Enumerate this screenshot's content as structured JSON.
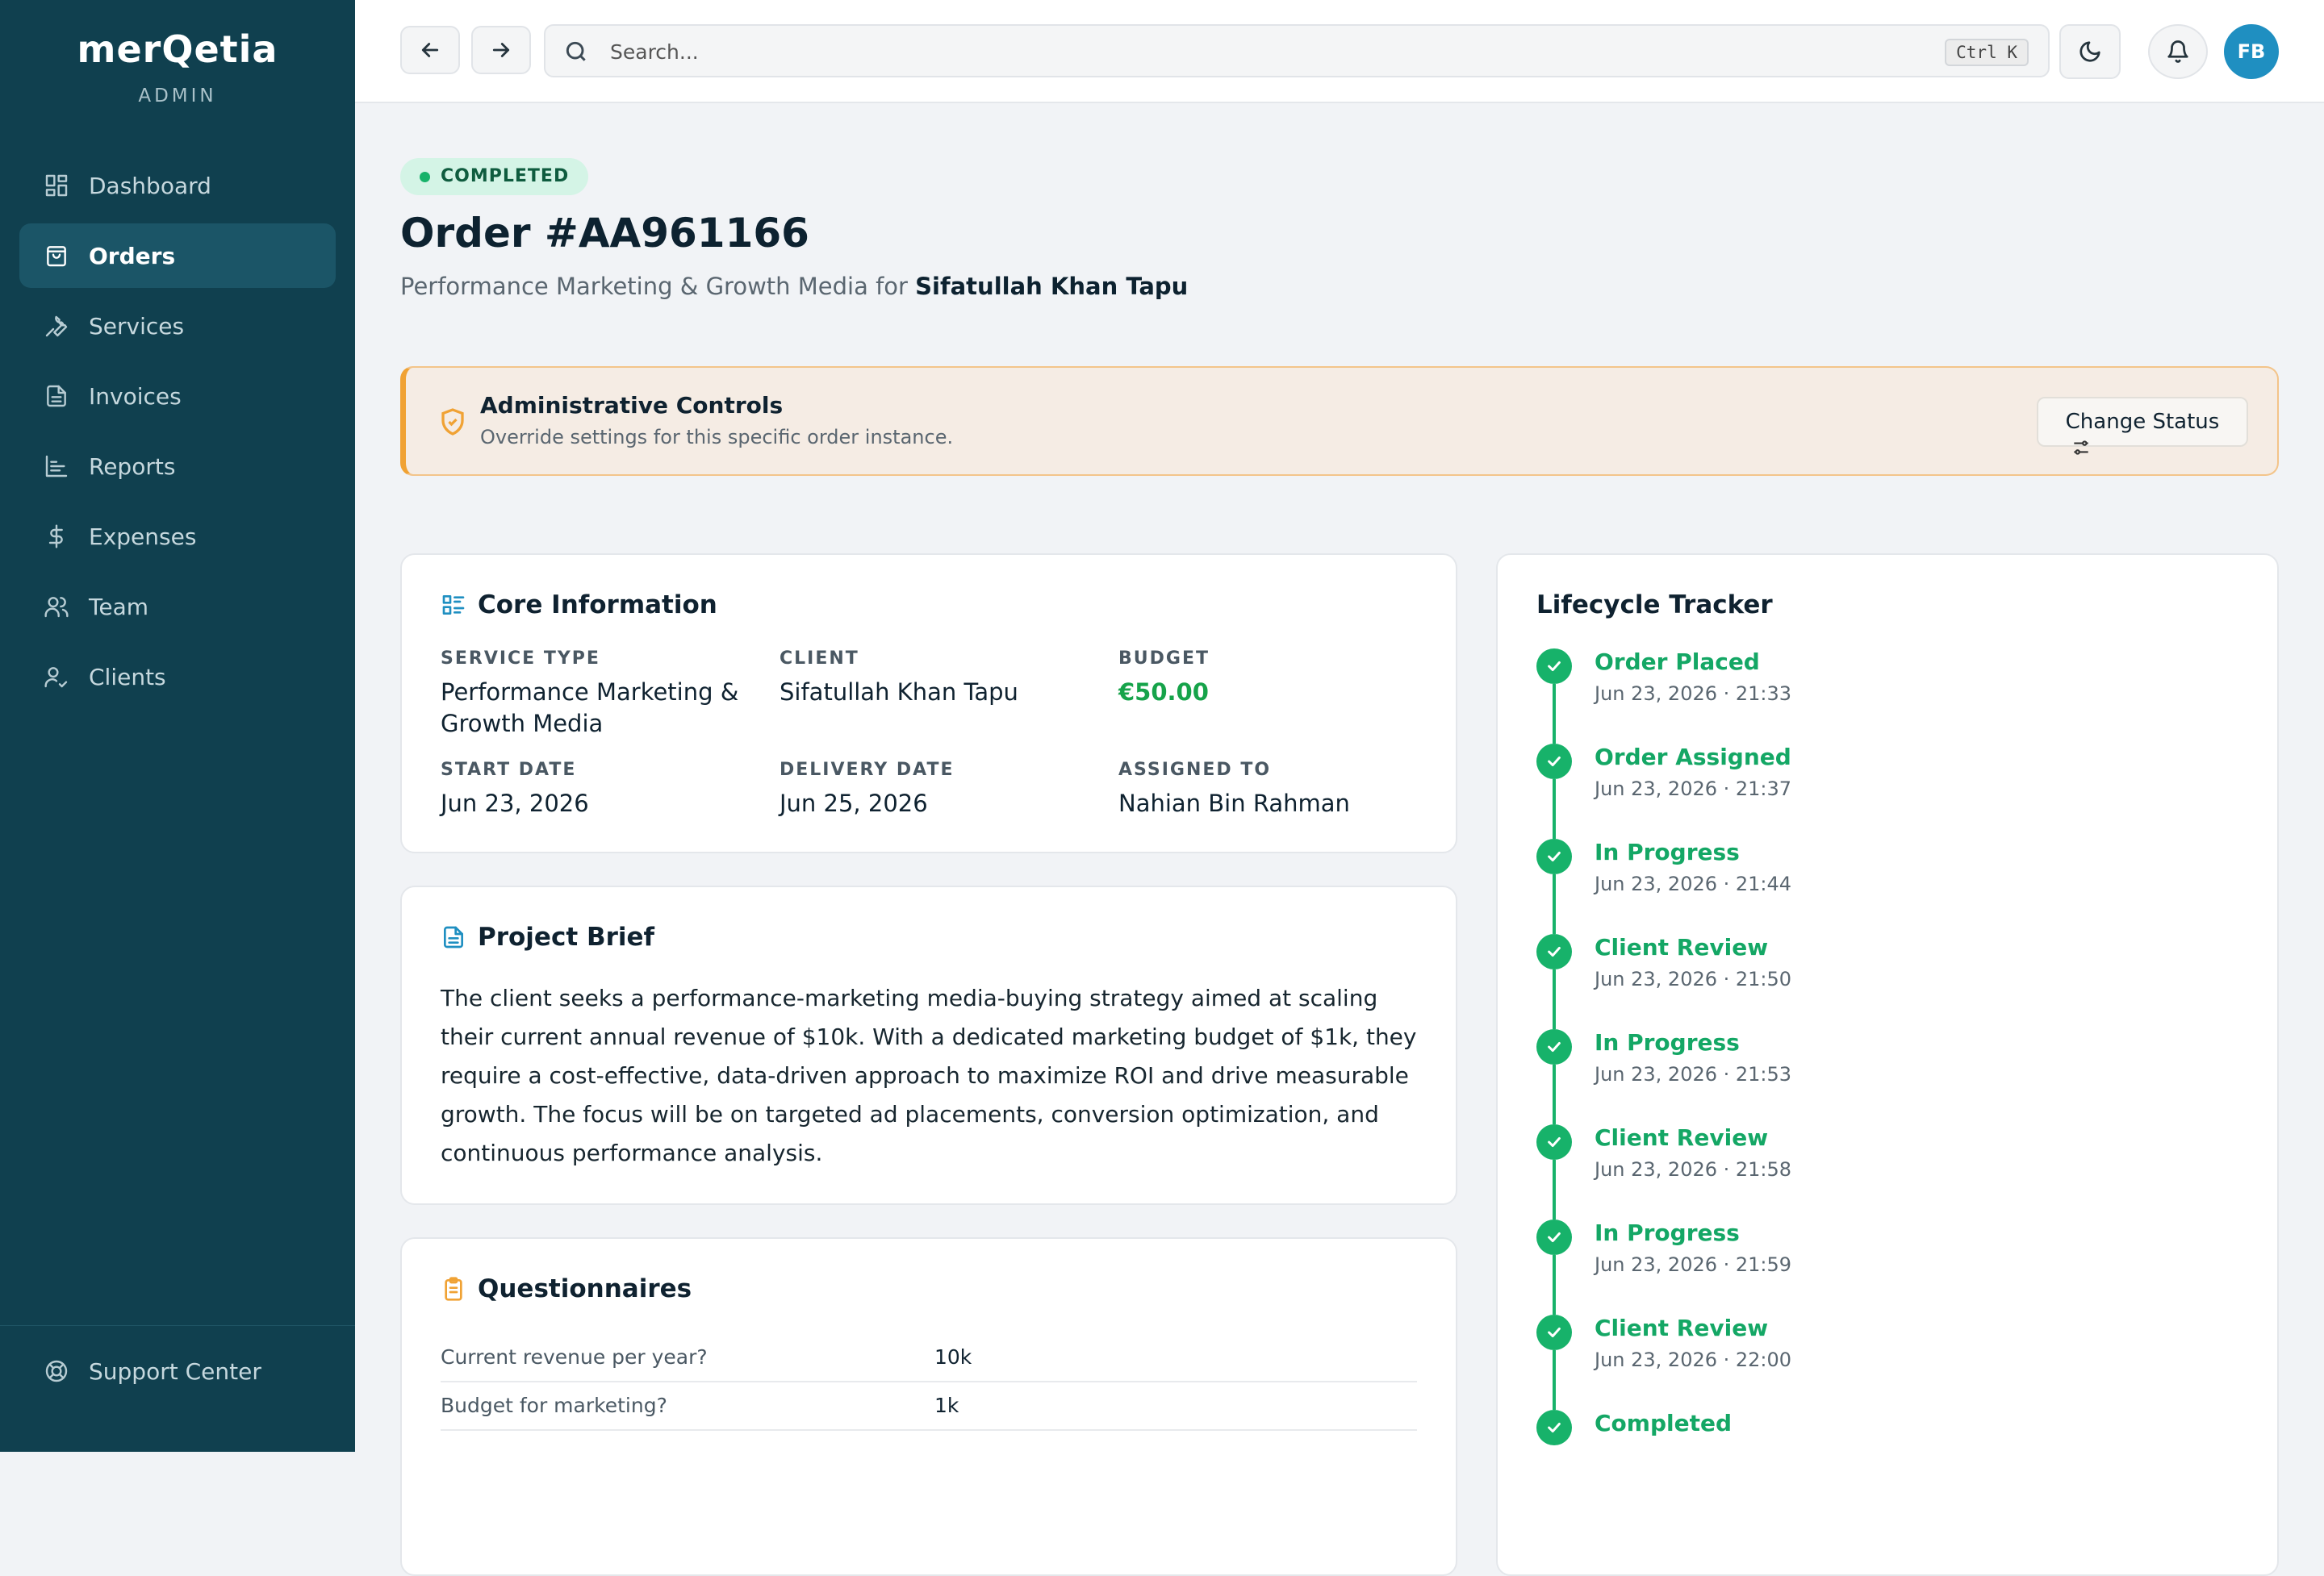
{
  "app": {
    "logo": "merQetia",
    "role": "ADMIN"
  },
  "sidebar": {
    "items": [
      {
        "label": "Dashboard",
        "icon": "dashboard-icon"
      },
      {
        "label": "Orders",
        "icon": "bag-icon",
        "active": true
      },
      {
        "label": "Services",
        "icon": "wrench-icon"
      },
      {
        "label": "Invoices",
        "icon": "document-icon"
      },
      {
        "label": "Reports",
        "icon": "chart-icon"
      },
      {
        "label": "Expenses",
        "icon": "dollar-icon"
      },
      {
        "label": "Team",
        "icon": "team-icon"
      },
      {
        "label": "Clients",
        "icon": "user-check-icon"
      }
    ],
    "support": "Support Center"
  },
  "topbar": {
    "search_placeholder": "Search...",
    "shortcut": "Ctrl K",
    "avatar_initials": "FB"
  },
  "order": {
    "status": "COMPLETED",
    "title": "Order #AA961166",
    "subtitle_prefix": "Performance Marketing & Growth Media for ",
    "client_name": "Sifatullah Khan Tapu"
  },
  "admin": {
    "title": "Administrative Controls",
    "description": "Override settings for this specific order instance.",
    "button": "Change Status"
  },
  "core": {
    "title": "Core Information",
    "fields": [
      {
        "label": "SERVICE TYPE",
        "value": "Performance Marketing & Growth Media"
      },
      {
        "label": "CLIENT",
        "value": "Sifatullah Khan Tapu"
      },
      {
        "label": "BUDGET",
        "value": "€50.00"
      },
      {
        "label": "START DATE",
        "value": "Jun 23, 2026"
      },
      {
        "label": "DELIVERY DATE",
        "value": "Jun 25, 2026"
      },
      {
        "label": "ASSIGNED TO",
        "value": "Nahian Bin Rahman"
      }
    ]
  },
  "brief": {
    "title": "Project Brief",
    "text": "The client seeks a performance-marketing media-buying strategy aimed at scaling their current annual revenue of $10k. With a dedicated marketing budget of $1k, they require a cost-effective, data-driven approach to maximize ROI and drive measurable growth. The focus will be on targeted ad placements, conversion optimization, and continuous performance analysis."
  },
  "questionnaires": {
    "title": "Questionnaires",
    "rows": [
      {
        "question": "Current revenue per year?",
        "answer": "10k"
      },
      {
        "question": "Budget for marketing?",
        "answer": "1k"
      }
    ]
  },
  "lifecycle": {
    "title": "Lifecycle Tracker",
    "events": [
      {
        "name": "Order Placed",
        "time": "Jun 23, 2026 · 21:33"
      },
      {
        "name": "Order Assigned",
        "time": "Jun 23, 2026 · 21:37"
      },
      {
        "name": "In Progress",
        "time": "Jun 23, 2026 · 21:44"
      },
      {
        "name": "Client Review",
        "time": "Jun 23, 2026 · 21:50"
      },
      {
        "name": "In Progress",
        "time": "Jun 23, 2026 · 21:53"
      },
      {
        "name": "Client Review",
        "time": "Jun 23, 2026 · 21:58"
      },
      {
        "name": "In Progress",
        "time": "Jun 23, 2026 · 21:59"
      },
      {
        "name": "Client Review",
        "time": "Jun 23, 2026 · 22:00"
      },
      {
        "name": "Completed",
        "time": ""
      }
    ]
  },
  "colors": {
    "sidebar": "#10404f",
    "accent_green": "#17b26a",
    "warning": "#f0a234",
    "avatar": "#1f8fc1"
  }
}
